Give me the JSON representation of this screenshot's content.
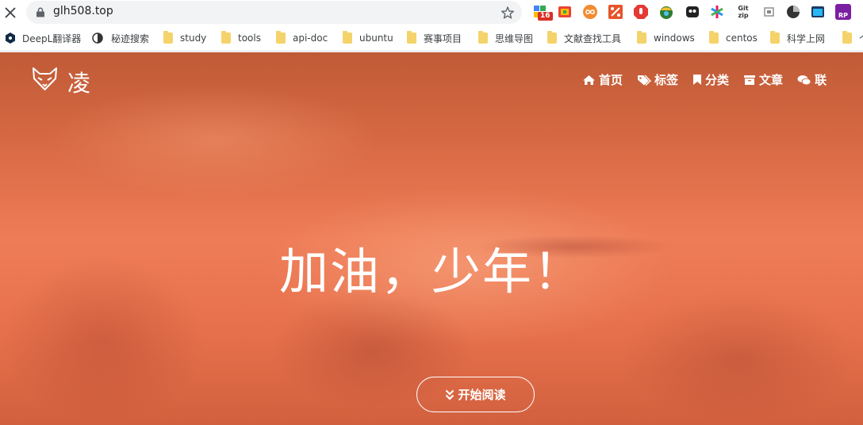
{
  "browser": {
    "url": "glh508.top",
    "extension_badge": "16",
    "extensions": [
      "extension-puzzle-icon",
      "chrome-webstore-icon",
      "infinity-icon",
      "percent-icon",
      "adblock-icon",
      "shield-icon",
      "ghost-icon",
      "asterisk-icon",
      "gitzip-icon",
      "reader-icon",
      "circle-icon",
      "tab-icon",
      "rp-icon"
    ],
    "gitzip_label": "Git zip",
    "rp_label": "RP"
  },
  "bookmarks": [
    {
      "label": "DeepL翻译器",
      "icon": "deepl-icon"
    },
    {
      "label": "秘迹搜索",
      "icon": "mijisou-icon"
    },
    {
      "label": "study",
      "icon": "folder-icon"
    },
    {
      "label": "tools",
      "icon": "folder-icon"
    },
    {
      "label": "api-doc",
      "icon": "folder-icon"
    },
    {
      "label": "ubuntu",
      "icon": "folder-icon"
    },
    {
      "label": "赛事项目",
      "icon": "folder-icon"
    },
    {
      "label": "思维导图",
      "icon": "folder-icon"
    },
    {
      "label": "文献查找工具",
      "icon": "folder-icon"
    },
    {
      "label": "windows",
      "icon": "folder-icon"
    },
    {
      "label": "centos",
      "icon": "folder-icon"
    },
    {
      "label": "科学上网",
      "icon": "folder-icon"
    },
    {
      "label": "个",
      "icon": "folder-icon"
    }
  ],
  "site": {
    "brand": "凌",
    "nav": [
      {
        "label": "首页",
        "icon": "home-icon"
      },
      {
        "label": "标签",
        "icon": "tags-icon"
      },
      {
        "label": "分类",
        "icon": "bookmark-icon"
      },
      {
        "label": "文章",
        "icon": "archive-icon"
      },
      {
        "label": "联",
        "icon": "comments-icon"
      }
    ],
    "headline": "加油，少年！",
    "read_button": "开始阅读"
  },
  "colors": {
    "hero_top": "#c05a36",
    "hero_mid": "#ee7c57",
    "omnibox": "#f1f3f4",
    "folder": "#f5d36b"
  }
}
